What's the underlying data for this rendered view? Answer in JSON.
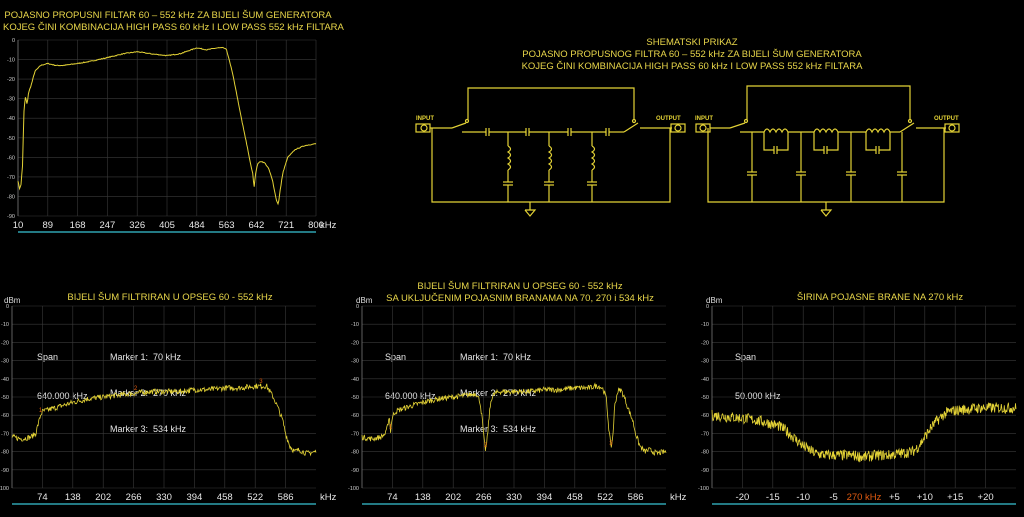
{
  "top_chart": {
    "title_lines": [
      "POJASNO PROPUSNI FILTAR 60 – 552 kHz ZA BIJELI ŠUM GENERATORA",
      "KOJEG ČINI KOMBINACIJA HIGH PASS 60 kHz I LOW PASS 552 kHz FILTARA"
    ]
  },
  "schematic": {
    "title_lines": [
      "SHEMATSKI PRIKAZ",
      "POJASNO PROPUSNOG FILTRA 60 – 552 kHz ZA BIJELI ŠUM GENERATORA",
      "KOJEG ČINI KOMBINACIJA HIGH PASS 60 kHz I LOW PASS 552 kHz FILTARA"
    ],
    "left_input": "INPUT",
    "left_output": "OUTPUT",
    "right_input": "INPUT",
    "right_output": "OUTPUT"
  },
  "panel1": {
    "unit": "dBm",
    "title_lines": [
      "BIJELI ŠUM FILTRIRAN U OPSEG  60 - 552 kHz"
    ],
    "span_label": "Span",
    "span_value": "640.000 kHz",
    "markers": [
      "Marker 1:  70 kHz",
      "Marker 2:  270 kHz",
      "Marker 3:  534 kHz"
    ]
  },
  "panel2": {
    "unit": "dBm",
    "title_lines": [
      "BIJELI ŠUM FILTRIRAN U OPSEG  60 - 552 kHz",
      "SA UKLJUČENIM  POJASNIM BRANAMA  NA 70, 270 i 534 kHz"
    ],
    "span_label": "Span",
    "span_value": "640.000 kHz",
    "markers": [
      "Marker 1:  70 kHz",
      "Marker 2:  270 kHz",
      "Marker 3:  534 kHz"
    ]
  },
  "panel3": {
    "unit": "dBm",
    "title_lines": [
      "ŠIRINA POJASNE BRANE  NA 270 kHz"
    ],
    "span_label": "Span",
    "span_value": "50.000 kHz"
  },
  "colors": {
    "trace": "#e4d336",
    "grid": "#3a3a3a",
    "axis": "#2fa3b0",
    "bg": "#000000",
    "text": "#e8e8e8",
    "marker_label": "#e05a10"
  },
  "chart_data": [
    {
      "type": "line",
      "name": "filter_response",
      "x_ticks": [
        "10",
        "89",
        "168",
        "247",
        "326",
        "405",
        "484",
        "563",
        "642",
        "721",
        "800"
      ],
      "x_unit": "kHz",
      "y_ticks": [
        "0",
        "-10",
        "-20",
        "-30",
        "-40",
        "-50",
        "-60",
        "-70",
        "-80",
        "-90"
      ],
      "xlim": [
        10,
        800
      ],
      "ylim": [
        -90,
        0
      ],
      "grid": true,
      "x": [
        10,
        14,
        18,
        22,
        26,
        30,
        34,
        38,
        45,
        55,
        70,
        89,
        110,
        130,
        168,
        200,
        247,
        290,
        326,
        360,
        405,
        440,
        484,
        510,
        540,
        555,
        563,
        580,
        600,
        615,
        625,
        632,
        636,
        640,
        646,
        655,
        665,
        675,
        685,
        695,
        700,
        705,
        712,
        725,
        745,
        770,
        800
      ],
      "y": [
        -72,
        -76,
        -74,
        -64,
        -35,
        -29,
        -33,
        -27,
        -23,
        -16,
        -13,
        -12,
        -13,
        -13,
        -12,
        -11,
        -9,
        -7,
        -6,
        -7,
        -8,
        -7,
        -4,
        -5,
        -4,
        -4,
        -5,
        -18,
        -38,
        -52,
        -62,
        -68,
        -75,
        -68,
        -63,
        -62,
        -63,
        -66,
        -72,
        -82,
        -84,
        -77,
        -68,
        -60,
        -56,
        -54,
        -53
      ]
    },
    {
      "type": "line",
      "name": "noise_filtered",
      "x_ticks": [
        "74",
        "138",
        "202",
        "266",
        "330",
        "394",
        "458",
        "522",
        "586"
      ],
      "x_unit": "kHz",
      "y_ticks": [
        "0",
        "-10",
        "-20",
        "-30",
        "-40",
        "-50",
        "-60",
        "-70",
        "-80",
        "-90",
        "-100"
      ],
      "xlim": [
        10,
        650
      ],
      "ylim": [
        -100,
        0
      ],
      "grid": true,
      "markers": [
        {
          "label": "1",
          "x": 70
        },
        {
          "label": "2",
          "x": 270
        },
        {
          "label": "3",
          "x": 534
        }
      ],
      "x": [
        10,
        30,
        50,
        60,
        66,
        70,
        74,
        100,
        138,
        170,
        202,
        234,
        266,
        300,
        330,
        362,
        394,
        426,
        458,
        490,
        522,
        534,
        546,
        560,
        570,
        580,
        586,
        595,
        605,
        615,
        630,
        650
      ],
      "y": [
        -72,
        -73,
        -72,
        -70,
        -64,
        -60,
        -58,
        -56,
        -53,
        -51,
        -50,
        -49,
        -48,
        -47,
        -47,
        -47,
        -46,
        -46,
        -45,
        -45,
        -44,
        -44,
        -44,
        -50,
        -56,
        -63,
        -70,
        -77,
        -80,
        -79,
        -81,
        -80
      ]
    },
    {
      "type": "line",
      "name": "noise_filtered_with_notches",
      "x_ticks": [
        "74",
        "138",
        "202",
        "266",
        "330",
        "394",
        "458",
        "522",
        "586"
      ],
      "x_unit": "kHz",
      "y_ticks": [
        "0",
        "-10",
        "-20",
        "-30",
        "-40",
        "-50",
        "-60",
        "-70",
        "-80",
        "-90",
        "-100"
      ],
      "xlim": [
        10,
        650
      ],
      "ylim": [
        -100,
        0
      ],
      "grid": true,
      "markers": [
        {
          "label": "1",
          "x": 70
        },
        {
          "label": "2",
          "x": 270
        },
        {
          "label": "3",
          "x": 534
        }
      ],
      "x": [
        10,
        30,
        50,
        60,
        64,
        67,
        70,
        73,
        76,
        80,
        100,
        138,
        170,
        202,
        234,
        250,
        258,
        263,
        267,
        270,
        273,
        277,
        282,
        290,
        300,
        330,
        362,
        394,
        426,
        458,
        490,
        500,
        508,
        516,
        524,
        530,
        534,
        538,
        542,
        548,
        555,
        562,
        570,
        580,
        586,
        595,
        605,
        615,
        630,
        650
      ],
      "y": [
        -72,
        -73,
        -72,
        -70,
        -66,
        -60,
        -69,
        -62,
        -60,
        -58,
        -56,
        -53,
        -51,
        -50,
        -49,
        -48,
        -52,
        -62,
        -74,
        -79,
        -75,
        -62,
        -51,
        -48,
        -47,
        -47,
        -47,
        -46,
        -46,
        -45,
        -45,
        -44,
        -44,
        -45,
        -50,
        -68,
        -78,
        -72,
        -55,
        -47,
        -46,
        -50,
        -56,
        -63,
        -70,
        -77,
        -80,
        -79,
        -81,
        -80
      ]
    },
    {
      "type": "line",
      "name": "notch_width_270",
      "x_ticks": [
        "-20",
        "-15",
        "-10",
        "-5",
        "270 kHz",
        "+5",
        "+10",
        "+15",
        "+20"
      ],
      "y_ticks": [
        "0",
        "-10",
        "-20",
        "-30",
        "-40",
        "-50",
        "-60",
        "-70",
        "-80",
        "-90",
        "-100"
      ],
      "xlim": [
        -25,
        25
      ],
      "ylim": [
        -100,
        0
      ],
      "grid": true,
      "x": [
        -25,
        -22,
        -19,
        -16,
        -14,
        -13,
        -12,
        -11,
        -10,
        -9,
        -8,
        -6,
        -4,
        -2,
        0,
        2,
        4,
        6,
        8,
        9,
        10,
        11,
        12,
        13,
        14,
        16,
        19,
        22,
        25
      ],
      "y": [
        -60,
        -61,
        -62,
        -64,
        -66,
        -68,
        -71,
        -74,
        -77,
        -79,
        -81,
        -82,
        -82,
        -82,
        -83,
        -82,
        -82,
        -81,
        -80,
        -77,
        -72,
        -67,
        -63,
        -60,
        -58,
        -57,
        -56,
        -56,
        -56
      ]
    }
  ]
}
